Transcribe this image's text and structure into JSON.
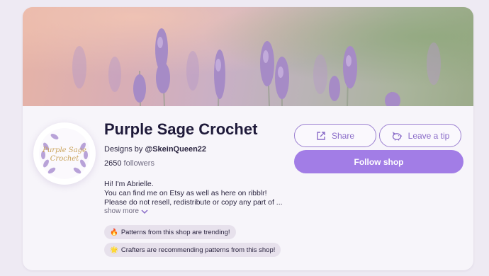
{
  "shop": {
    "name": "Purple Sage Crochet",
    "designs_by_prefix": "Designs by ",
    "designer_handle": "@SkeinQueen22",
    "followers_count": "2650",
    "followers_label": "followers",
    "avatar_logo_text": "Purple Sage Crochet"
  },
  "bio": {
    "lines": [
      "Hi! I'm Abrielle.",
      "You can find me on Etsy as well as here on ribblr!",
      "Please do not resell, redistribute or copy any part of ..."
    ],
    "show_more_label": "show more"
  },
  "badges": [
    {
      "emoji": "🔥",
      "text": "Patterns from this shop are trending!"
    },
    {
      "emoji": "🌟",
      "text": "Crafters are recommending patterns from this shop!"
    }
  ],
  "actions": {
    "share_label": "Share",
    "tip_label": "Leave a tip",
    "follow_label": "Follow shop"
  },
  "colors": {
    "accent": "#a27de6",
    "accent_text": "#8a6cc8",
    "title": "#1f1a3a",
    "badge_bg": "#e7e1ec",
    "page_bg": "#eeeaf3"
  },
  "icons": {
    "share": "share-out-icon",
    "tip": "piggy-bank-icon",
    "show_more": "chevron-down-icon",
    "avatar_decor": "lavender-wreath-icon"
  }
}
